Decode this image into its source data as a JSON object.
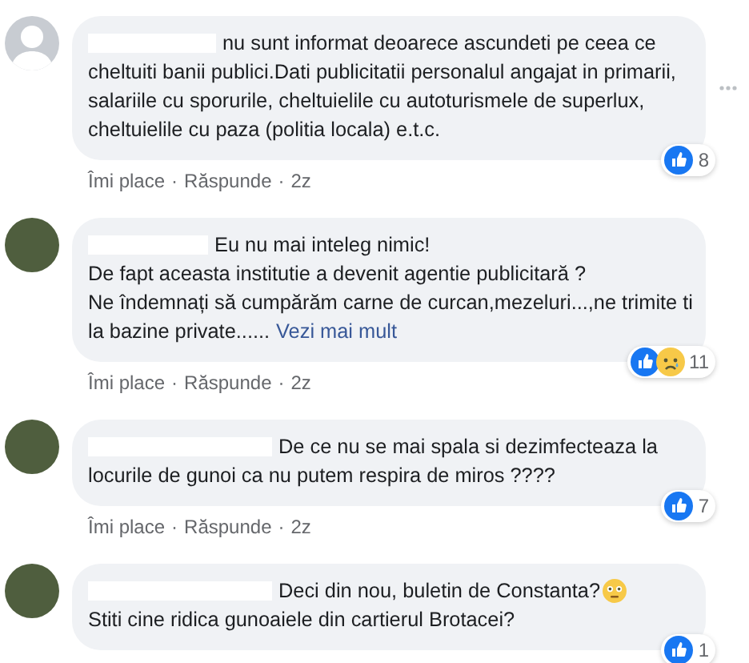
{
  "comments": [
    {
      "avatar": {
        "kind": "silhouette"
      },
      "lines": [
        {
          "text": "nu sunt informat deoarece ascundeti pe ceea ce"
        },
        {
          "text": "cheltuiti banii publici.Dati publicitatii personalul angajat in primarii,"
        },
        {
          "text": "salariile cu sporurile, cheltuielile cu autoturismele de superlux,"
        },
        {
          "text": "cheltuielile cu paza (politia locala) e.t.c."
        }
      ],
      "reactions": [
        {
          "kind": "like"
        }
      ],
      "reaction_count": "8",
      "actions": [
        "Îmi place",
        "Răspunde",
        "2z"
      ],
      "separator": "·",
      "more_menu": true
    },
    {
      "avatar": {
        "kind": "photo"
      },
      "lines": [
        {
          "text": "Eu nu mai inteleg nimic!"
        },
        {
          "text": "De fapt aceasta institutie a devenit agentie publicitară ?"
        },
        {
          "text": "Ne îndemnați să cumpărăm carne de curcan,mezeluri...,ne trimite ti"
        },
        {
          "text": "la bazine private......",
          "link": "Vezi mai mult"
        }
      ],
      "reactions": [
        {
          "kind": "like"
        },
        {
          "kind": "sad"
        }
      ],
      "reaction_count": "11",
      "actions": [
        "Îmi place",
        "Răspunde",
        "2z"
      ],
      "separator": "·",
      "more_menu": false
    },
    {
      "avatar": {
        "kind": "photo"
      },
      "lines": [
        {
          "text": "De ce nu se mai spala si dezimfecteaza la"
        },
        {
          "text": "locurile de gunoi ca nu putem respira de miros ????"
        }
      ],
      "reactions": [
        {
          "kind": "like"
        }
      ],
      "reaction_count": "7",
      "actions": [
        "Îmi place",
        "Răspunde",
        "2z"
      ],
      "separator": "·",
      "more_menu": false
    },
    {
      "avatar": {
        "kind": "photo"
      },
      "lines": [
        {
          "text": "Deci din nou, buletin de Constanta?",
          "emoji": {
            "kind": "flushed"
          }
        },
        {
          "text": "Stiti cine ridica gunoaiele din cartierul Brotacei?"
        }
      ],
      "reactions": [
        {
          "kind": "like"
        }
      ],
      "reaction_count": "1",
      "more_menu": false
    }
  ]
}
